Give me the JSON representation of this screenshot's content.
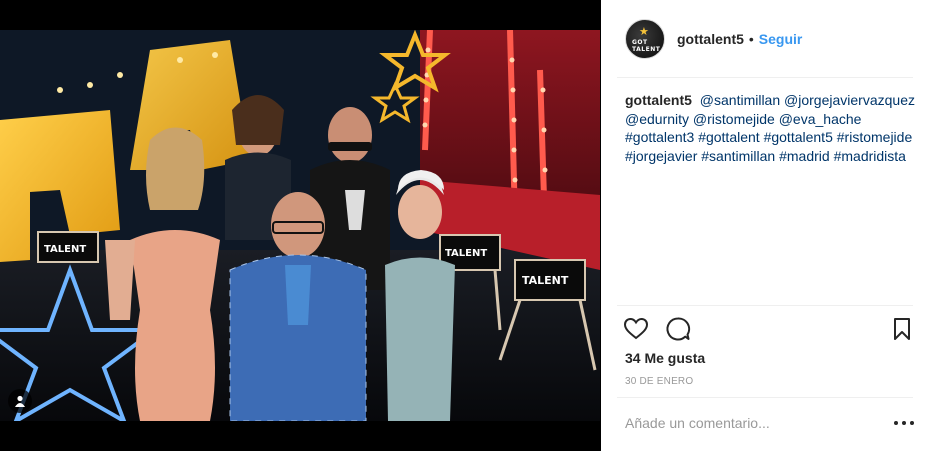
{
  "post": {
    "username": "gottalent5",
    "separator": "•",
    "follow_label": "Seguir",
    "avatar_text": "GOT TALENT",
    "caption_user": "gottalent5",
    "caption_tags": [
      "@santimillan",
      "@jorgejaviervazquez",
      "@edurnity",
      "@ristomejide",
      "@eva_hache",
      "#gottalent3",
      "#gottalent",
      "#gottalent5",
      "#ristomejide",
      "#jorgejavier",
      "#santimillan",
      "#madrid",
      "#madridista"
    ],
    "likes": "34 Me gusta",
    "date": "30 DE ENERO",
    "comment_placeholder": "Añade un comentario...",
    "photo_chair_text": "TALENT"
  },
  "icons": {
    "like": "heart-icon",
    "comment": "comment-icon",
    "save": "bookmark-icon",
    "tag": "user-tag-icon",
    "more": "more-options-icon"
  },
  "colors": {
    "follow": "#3897f0",
    "hashtag": "#003569",
    "text": "#262626",
    "muted": "#999999"
  }
}
